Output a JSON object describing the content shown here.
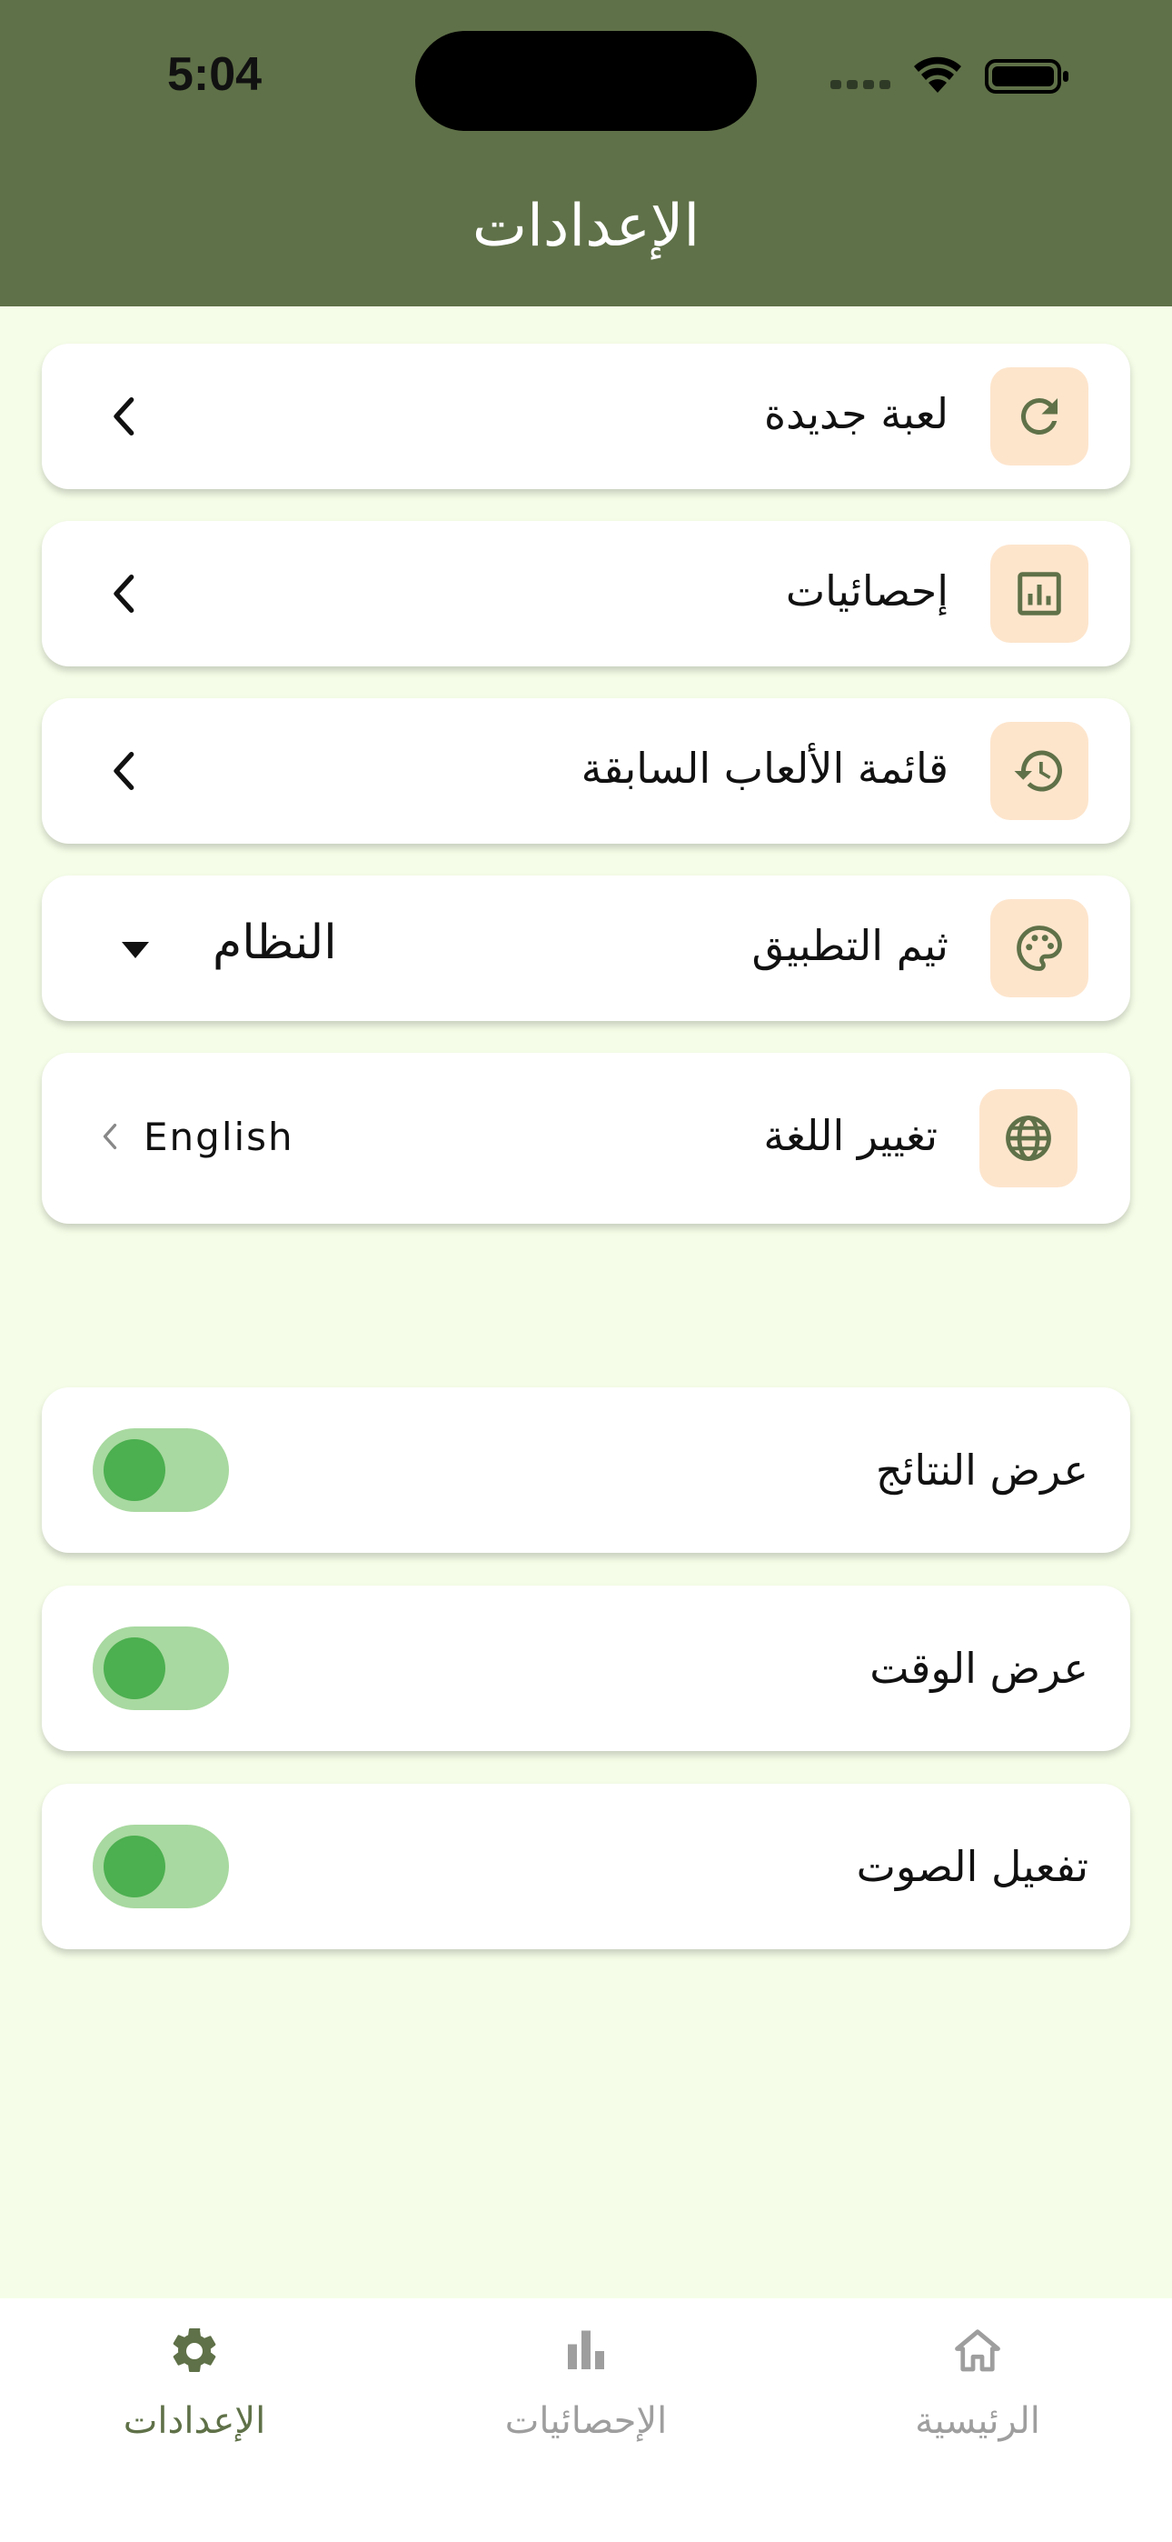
{
  "status_bar": {
    "time": "5:04"
  },
  "header": {
    "title": "الإعدادات"
  },
  "menu": {
    "new_game": {
      "label": "لعبة جديدة",
      "icon": "refresh-icon"
    },
    "statistics": {
      "label": "إحصائيات",
      "icon": "chart-icon"
    },
    "history": {
      "label": "قائمة الألعاب السابقة",
      "icon": "history-icon"
    },
    "theme": {
      "label": "ثيم التطبيق",
      "icon": "palette-icon",
      "selected": "النظام"
    },
    "language": {
      "label": "تغيير اللغة",
      "icon": "globe-icon",
      "selected": "English"
    }
  },
  "toggles": {
    "show_results": {
      "label": "عرض النتائج",
      "on": true
    },
    "show_time": {
      "label": "عرض الوقت",
      "on": true
    },
    "sound": {
      "label": "تفعيل الصوت",
      "on": true
    }
  },
  "bottom_nav": {
    "settings": {
      "label": "الإعدادات",
      "active": true
    },
    "statistics": {
      "label": "الإحصائيات",
      "active": false
    },
    "home": {
      "label": "الرئيسية",
      "active": false
    }
  },
  "colors": {
    "header": "#5f7148",
    "background": "#f5fde8",
    "icon_bg": "#fde5cc",
    "icon_fg": "#5f7148",
    "toggle_track": "#a8d9a0",
    "toggle_knob": "#4caf50",
    "nav_inactive": "#9e9e9e"
  }
}
